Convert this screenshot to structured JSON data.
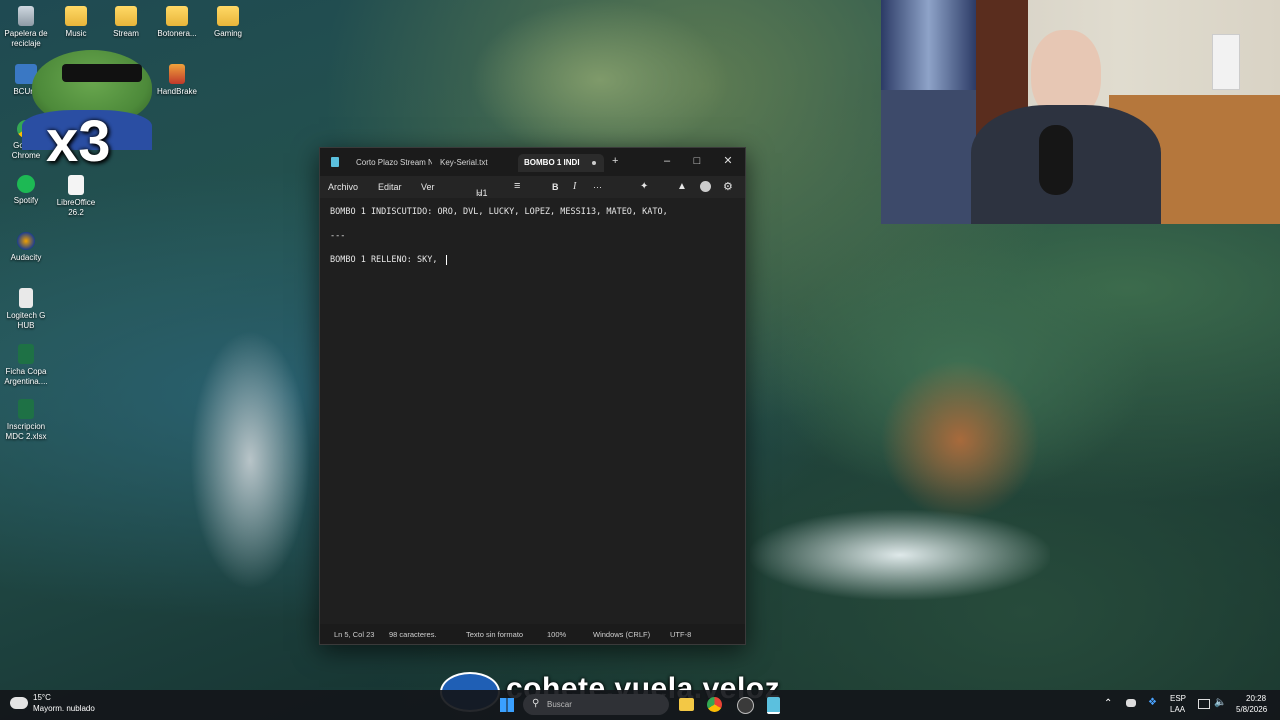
{
  "desktop_icons": [
    {
      "label": "Papelera de reciclaje",
      "icon": "recycle-bin-icon"
    },
    {
      "label": "Music",
      "icon": "folder-icon"
    },
    {
      "label": "Stream",
      "icon": "folder-icon"
    },
    {
      "label": "Botonera...",
      "icon": "folder-icon"
    },
    {
      "label": "Gaming",
      "icon": "folder-icon"
    },
    {
      "label": "BCUnit",
      "icon": "app-icon"
    },
    {
      "label": "HandBrake",
      "icon": "handbrake-icon"
    },
    {
      "label": "Google Chrome",
      "icon": "chrome-icon"
    },
    {
      "label": "Spotify",
      "icon": "spotify-icon"
    },
    {
      "label": "LibreOffice 26.2",
      "icon": "libreoffice-icon"
    },
    {
      "label": "Audacity",
      "icon": "audacity-icon"
    },
    {
      "label": "Logitech G HUB",
      "icon": "logitech-icon"
    },
    {
      "label": "Ficha Copa Argentina....",
      "icon": "excel-icon"
    },
    {
      "label": "Inscripcion MDC 2.xlsx",
      "icon": "excel-icon"
    }
  ],
  "overlay_badge": "x3",
  "notepad": {
    "tabs": [
      "Corto Plazo Stream N",
      "Key-Serial.txt",
      "BOMBO 1 INDI"
    ],
    "new_tab": "+",
    "menu": [
      "Archivo",
      "Editar",
      "Ver"
    ],
    "heading_select": "H1",
    "bold": "B",
    "italic": "I",
    "more": "···",
    "lines": [
      "BOMBO 1 INDISCUTIDO: ORO, DVL, LUCKY, LOPEZ, MESSI13, MATEO, KATO,",
      "---",
      "BOMBO 1 RELLENO: SKY, "
    ],
    "status": {
      "position": "Ln 5, Col 23",
      "chars": "98 caracteres.",
      "format": "Texto sin formato",
      "zoom": "100%",
      "line_ending": "Windows (CRLF)",
      "encoding": "UTF-8"
    }
  },
  "stream_overlay": "cohete.vuela.veloz",
  "taskbar": {
    "weather_temp": "15°C",
    "weather_desc": "Mayorm. nublado",
    "search_placeholder": "Buscar",
    "lang_top": "ESP",
    "lang_bottom": "LAA",
    "time": "20:28",
    "date": "5/8/2026"
  }
}
